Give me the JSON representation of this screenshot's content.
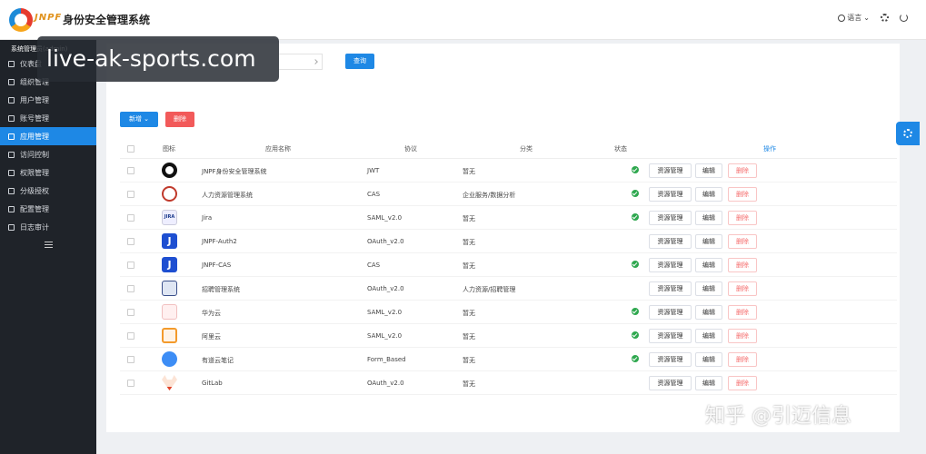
{
  "header": {
    "brand": "JNPF",
    "title": "身份安全管理系统",
    "language_label": "语言"
  },
  "sidebar": {
    "caption": "系统管理员(admin)",
    "items": [
      {
        "label": "仪表盘",
        "active": false
      },
      {
        "label": "组织管理",
        "active": false
      },
      {
        "label": "用户管理",
        "active": false
      },
      {
        "label": "账号管理",
        "active": false
      },
      {
        "label": "应用管理",
        "active": true
      },
      {
        "label": "访问控制",
        "active": false
      },
      {
        "label": "权限管理",
        "active": false
      },
      {
        "label": "分级授权",
        "active": false
      },
      {
        "label": "配置管理",
        "active": false
      },
      {
        "label": "日志审计",
        "active": false
      }
    ]
  },
  "watermark": {
    "site": "live-ak-sports.com",
    "zhihu": "知乎 @引迈信息"
  },
  "toolbar": {
    "query_label": "查询",
    "add_label": "新增",
    "delete_label": "删除"
  },
  "table": {
    "headers": {
      "icon": "图标",
      "name": "应用名称",
      "protocol": "协议",
      "category": "分类",
      "status": "状态",
      "actions": "操作"
    },
    "action_labels": {
      "resource": "资源管理",
      "edit": "编辑",
      "delete": "删除"
    },
    "rows": [
      {
        "icon": "jnpf-logo-icon",
        "name": "JNPF身份安全管理系统",
        "protocol": "JWT",
        "category": "暂无",
        "enabled": true
      },
      {
        "icon": "hr-logo-icon",
        "name": "人力资源管理系统",
        "protocol": "CAS",
        "category": "企业服务/数据分析",
        "enabled": true
      },
      {
        "icon": "jira-logo-icon",
        "name": "Jira",
        "protocol": "SAML_v2.0",
        "category": "暂无",
        "enabled": true
      },
      {
        "icon": "j-letter-icon",
        "name": "JNPF-Auth2",
        "protocol": "OAuth_v2.0",
        "category": "暂无",
        "enabled": false
      },
      {
        "icon": "j-letter-icon",
        "name": "JNPF-CAS",
        "protocol": "CAS",
        "category": "暂无",
        "enabled": true
      },
      {
        "icon": "hiring-logo-icon",
        "name": "招聘管理系统",
        "protocol": "OAuth_v2.0",
        "category": "人力资源/招聘管理",
        "enabled": false
      },
      {
        "icon": "huawei-cloud-icon",
        "name": "华为云",
        "protocol": "SAML_v2.0",
        "category": "暂无",
        "enabled": true
      },
      {
        "icon": "aliyun-icon",
        "name": "阿里云",
        "protocol": "SAML_v2.0",
        "category": "暂无",
        "enabled": true
      },
      {
        "icon": "youdao-note-icon",
        "name": "有道云笔记",
        "protocol": "Form_Based",
        "category": "暂无",
        "enabled": true
      },
      {
        "icon": "gitlab-icon",
        "name": "GitLab",
        "protocol": "OAuth_v2.0",
        "category": "暂无",
        "enabled": false
      }
    ]
  }
}
